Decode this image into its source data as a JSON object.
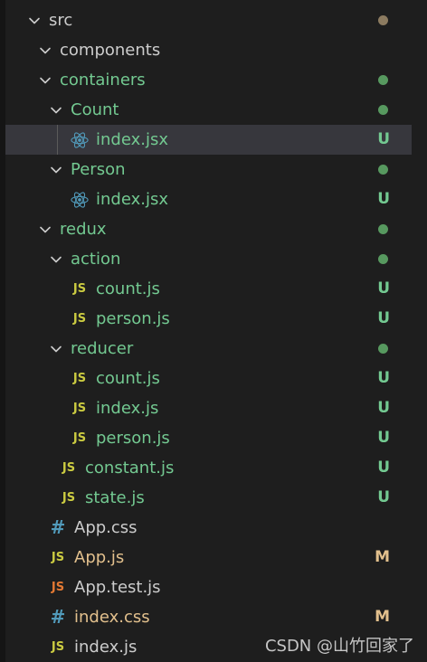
{
  "tree": {
    "rows": [
      {
        "label": "src",
        "kind": "folder",
        "open": true,
        "indent": 0,
        "color": "white",
        "status": "dot-brown"
      },
      {
        "label": "components",
        "kind": "folder",
        "open": true,
        "indent": 1,
        "color": "white",
        "status": ""
      },
      {
        "label": "containers",
        "kind": "folder",
        "open": true,
        "indent": 1,
        "color": "green",
        "status": "dot-green"
      },
      {
        "label": "Count",
        "kind": "folder",
        "open": true,
        "indent": 2,
        "color": "green",
        "status": "dot-green"
      },
      {
        "label": "index.jsx",
        "kind": "react",
        "indent": 3,
        "color": "green",
        "status": "U",
        "selected": true
      },
      {
        "label": "Person",
        "kind": "folder",
        "open": true,
        "indent": 2,
        "color": "green",
        "status": "dot-green"
      },
      {
        "label": "index.jsx",
        "kind": "react",
        "indent": 3,
        "color": "green",
        "status": "U"
      },
      {
        "label": "redux",
        "kind": "folder",
        "open": true,
        "indent": 1,
        "color": "green",
        "status": "dot-green"
      },
      {
        "label": "action",
        "kind": "folder",
        "open": true,
        "indent": 2,
        "color": "green",
        "status": "dot-green"
      },
      {
        "label": "count.js",
        "kind": "js",
        "indent": 3,
        "color": "green",
        "status": "U"
      },
      {
        "label": "person.js",
        "kind": "js",
        "indent": 3,
        "color": "green",
        "status": "U"
      },
      {
        "label": "reducer",
        "kind": "folder",
        "open": true,
        "indent": 2,
        "color": "green",
        "status": "dot-green"
      },
      {
        "label": "count.js",
        "kind": "js",
        "indent": 3,
        "color": "green",
        "status": "U"
      },
      {
        "label": "index.js",
        "kind": "js",
        "indent": 3,
        "color": "green",
        "status": "U"
      },
      {
        "label": "person.js",
        "kind": "js",
        "indent": 3,
        "color": "green",
        "status": "U"
      },
      {
        "label": "constant.js",
        "kind": "js",
        "indent": 2,
        "color": "green",
        "status": "U"
      },
      {
        "label": "state.js",
        "kind": "js",
        "indent": 2,
        "color": "green",
        "status": "U"
      },
      {
        "label": "App.css",
        "kind": "css",
        "indent": 1,
        "color": "white",
        "status": ""
      },
      {
        "label": "App.js",
        "kind": "js",
        "indent": 1,
        "color": "orange",
        "status": "M"
      },
      {
        "label": "App.test.js",
        "kind": "js-red",
        "indent": 1,
        "color": "white",
        "status": ""
      },
      {
        "label": "index.css",
        "kind": "css",
        "indent": 1,
        "color": "orange",
        "status": "M"
      },
      {
        "label": "index.js",
        "kind": "js",
        "indent": 1,
        "color": "white",
        "status": ""
      }
    ]
  },
  "icons": {
    "js_text": "JS",
    "css_text": "#"
  },
  "colors": {
    "background": "#1e1e1e",
    "selected_row": "#37373d",
    "untracked_green": "#73c991",
    "modified_orange": "#e2c08d",
    "folder_dot_green": "#57995f",
    "folder_dot_brown": "#8c7b60",
    "js_yellow": "#cbcb41",
    "css_blue": "#519aba",
    "react_blue": "#519aba"
  },
  "watermark": {
    "text": "CSDN @山竹回家了"
  }
}
